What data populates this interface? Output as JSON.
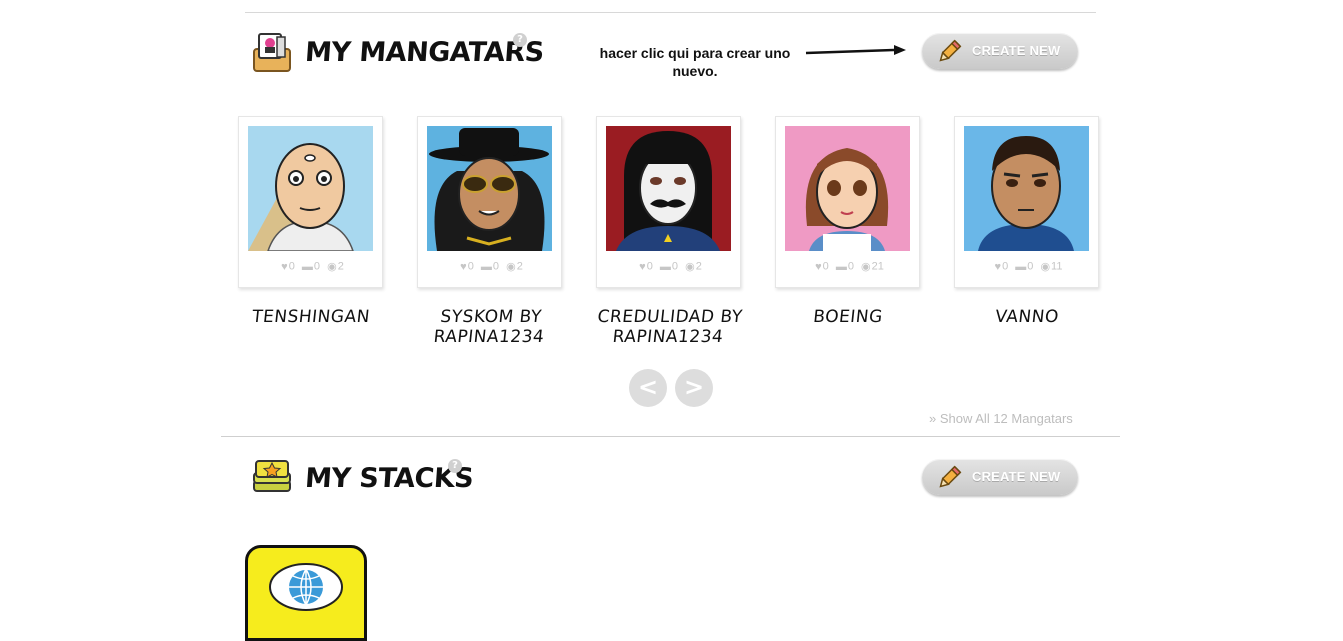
{
  "mangatars_section": {
    "title": "MY MANGATARS",
    "help": "?",
    "annotation": "hacer clic qui para crear uno nuevo.",
    "create_button": "CREATE NEW",
    "cards": [
      {
        "name": "TENSHINGAN",
        "likes": "0",
        "comments": "0",
        "views": "2",
        "bg": "#a8d8ef"
      },
      {
        "name": "SYSKOM BY RAPINA1234",
        "likes": "0",
        "comments": "0",
        "views": "2",
        "bg": "#5eb2e0"
      },
      {
        "name": "CREDULIDAD BY RAPINA1234",
        "likes": "0",
        "comments": "0",
        "views": "2",
        "bg": "#9a1c22"
      },
      {
        "name": "BOEING",
        "likes": "0",
        "comments": "0",
        "views": "21",
        "bg": "#ef9ac4"
      },
      {
        "name": "VANNO",
        "likes": "0",
        "comments": "0",
        "views": "11",
        "bg": "#6ab7e8"
      }
    ],
    "prev": "<",
    "next": ">",
    "show_all": "» Show All 12 Mangatars"
  },
  "stacks_section": {
    "title": "MY STACKS",
    "help": "?",
    "create_button": "CREATE NEW"
  },
  "icons": {
    "mangatars": "mangatar-box-icon",
    "stacks": "stack-star-icon",
    "create": "pencil-icon",
    "like": "heart-icon",
    "comment": "comment-icon",
    "view": "eye-icon",
    "stack_tile": "globe-icon"
  }
}
